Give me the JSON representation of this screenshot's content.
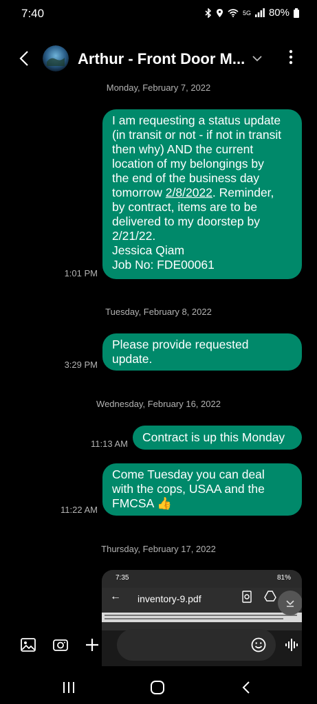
{
  "status_bar": {
    "time": "7:40",
    "network": "5G",
    "battery": "80%"
  },
  "header": {
    "contact_name": "Arthur - Front Door M..."
  },
  "messages": [
    {
      "date": "Monday, February 7, 2022",
      "time": "1:01 PM",
      "lines": [
        "I am requesting a status update",
        "(in transit or not - if not in transit",
        "then why) AND the current",
        "location of my belongings by",
        "the end of the business day",
        "tomorrow 2/8/2022. Reminder,",
        "by contract, items are to be",
        "delivered to my doorstep by",
        "2/21/22.",
        "Jessica Qiam",
        "Job No: FDE00061"
      ]
    },
    {
      "date": "Tuesday, February 8, 2022",
      "time": "3:29 PM",
      "lines": [
        "Please provide requested",
        "update."
      ]
    },
    {
      "date": "Wednesday, February 16, 2022",
      "time": "11:13 AM",
      "lines": [
        "Contract is up this Monday"
      ]
    },
    {
      "time": "11:22 AM",
      "lines": [
        "Come Tuesday you can deal",
        "with the cops, USAA and the",
        "FMCSA 👍"
      ]
    },
    {
      "date": "Thursday, February 17, 2022"
    }
  ],
  "attachment": {
    "time": "7:35",
    "battery": "81%",
    "filename": "inventory-9.pdf"
  },
  "colors": {
    "bubble": "#00896a",
    "background": "#000000"
  }
}
